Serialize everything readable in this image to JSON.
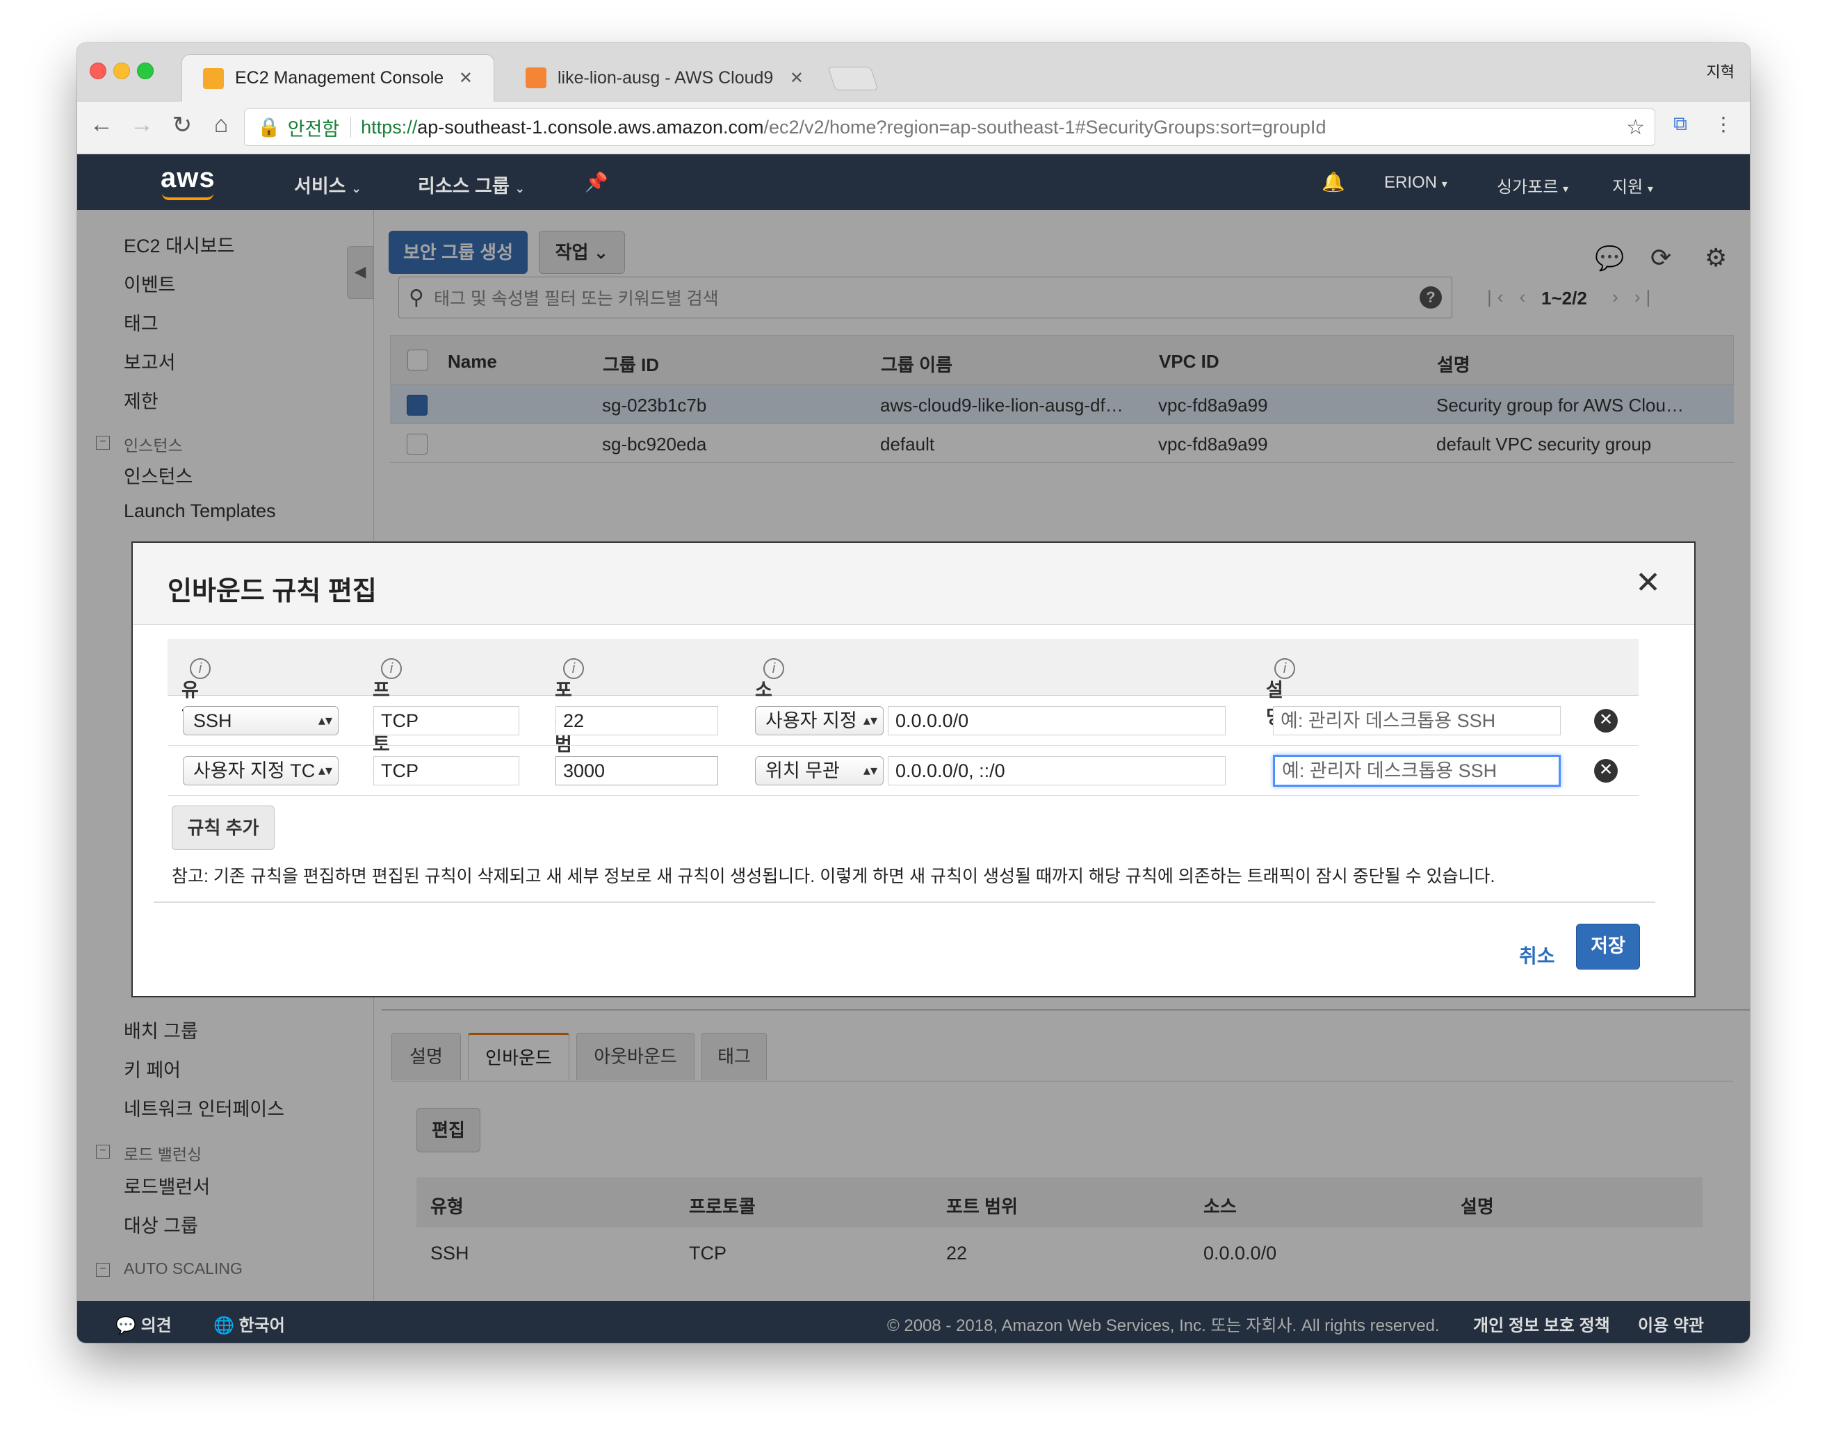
{
  "browser": {
    "tabs": [
      {
        "title": "EC2 Management Console",
        "active": true
      },
      {
        "title": "like-lion-ausg - AWS Cloud9",
        "active": false
      }
    ],
    "profile": "지혁",
    "secure_label": "안전함",
    "url_proto": "https://",
    "url_host": "ap-southeast-1.console.aws.amazon.com",
    "url_path": "/ec2/v2/home?region=ap-southeast-1#SecurityGroups:sort=groupId"
  },
  "aws_nav": {
    "logo": "aws",
    "services": "서비스",
    "resource_groups": "리소스 그룹",
    "account": "ERION",
    "region": "싱가포르",
    "support": "지원"
  },
  "sidebar": {
    "top_items": [
      "EC2 대시보드",
      "이벤트",
      "태그",
      "보고서",
      "제한"
    ],
    "instances_header": "인스턴스",
    "instances_items": [
      "인스턴스",
      "Launch Templates"
    ],
    "network_items": [
      "배치 그룹",
      "키 페어",
      "네트워크 인터페이스"
    ],
    "lb_header": "로드 밸런싱",
    "lb_items": [
      "로드밸런서",
      "대상 그룹"
    ],
    "autoscaling_header": "AUTO SCALING"
  },
  "toolbar": {
    "create_sg": "보안 그룹 생성",
    "actions": "작업",
    "search_placeholder": "태그 및 속성별 필터 또는 키워드별 검색",
    "pagination": "1~2/2"
  },
  "sg_table": {
    "headers": [
      "Name",
      "그룹 ID",
      "그룹 이름",
      "VPC ID",
      "설명"
    ],
    "rows": [
      {
        "name": "",
        "group_id": "sg-023b1c7b",
        "group_name": "aws-cloud9-like-lion-ausg-df…",
        "vpc_id": "vpc-fd8a9a99",
        "desc": "Security group for AWS Clou…",
        "selected": true
      },
      {
        "name": "",
        "group_id": "sg-bc920eda",
        "group_name": "default",
        "vpc_id": "vpc-fd8a9a99",
        "desc": "default VPC security group",
        "selected": false
      }
    ]
  },
  "detail": {
    "tabs": [
      "설명",
      "인바운드",
      "아웃바운드",
      "태그"
    ],
    "active_tab": "인바운드",
    "edit_button": "편집",
    "headers": [
      "유형",
      "프로토콜",
      "포트 범위",
      "소스",
      "설명"
    ],
    "rows": [
      {
        "type": "SSH",
        "protocol": "TCP",
        "port": "22",
        "source": "0.0.0.0/0",
        "desc": ""
      }
    ]
  },
  "modal": {
    "title": "인바운드 규칙 편집",
    "headers": [
      "유형",
      "프로토콜",
      "포트 범위",
      "소스",
      "설명"
    ],
    "rules": [
      {
        "type": "SSH",
        "protocol": "TCP",
        "port": "22",
        "source_type": "사용자 지정",
        "source": "0.0.0.0/0",
        "desc_placeholder": "예: 관리자 데스크톱용 SSH"
      },
      {
        "type": "사용자 지정 TC",
        "protocol": "TCP",
        "port": "3000",
        "source_type": "위치 무관",
        "source": "0.0.0.0/0, ::/0",
        "desc_placeholder": "예: 관리자 데스크톱용 SSH"
      }
    ],
    "add_rule": "규칙 추가",
    "note": "참고: 기존 규칙을 편집하면 편집된 규칙이 삭제되고 새 세부 정보로 새 규칙이 생성됩니다. 이렇게 하면 새 규칙이 생성될 때까지 해당 규칙에 의존하는 트래픽이 잠시 중단될 수 있습니다.",
    "cancel": "취소",
    "save": "저장"
  },
  "footer": {
    "feedback": "의견",
    "language": "한국어",
    "copyright": "© 2008 - 2018, Amazon Web Services, Inc. 또는 자회사. All rights reserved.",
    "privacy": "개인 정보 보호 정책",
    "terms": "이용 약관"
  },
  "colors": {
    "aws_nav": "#232f3e",
    "primary": "#3b6fb6",
    "accent_orange": "#ff9900"
  }
}
